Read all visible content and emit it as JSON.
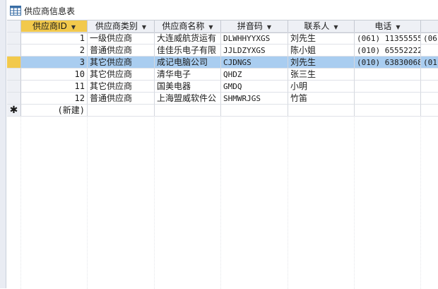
{
  "window": {
    "title": "供应商信息表",
    "icon": "table-icon"
  },
  "columns": [
    "供应商ID",
    "供应商类别",
    "供应商名称",
    "拼音码",
    "联系人",
    "电话",
    ""
  ],
  "rows": [
    [
      "1",
      "一级供应商",
      "大连威航货运有",
      "DLWHHYYXGS",
      "刘先生",
      "(061) 11355555",
      "(06"
    ],
    [
      "2",
      "普通供应商",
      "佳佳乐电子有限",
      "JJLDZYXGS",
      "陈小姐",
      "(010) 65552222",
      ""
    ],
    [
      "3",
      "其它供应商",
      "成记电脑公司",
      "CJDNGS",
      "刘先生",
      "(010) 63830068",
      "(01"
    ],
    [
      "10",
      "其它供应商",
      "清华电子",
      "QHDZ",
      "张三生",
      "",
      ""
    ],
    [
      "11",
      "其它供应商",
      "国美电器",
      "GMDQ",
      "小明",
      "",
      ""
    ],
    [
      "12",
      "普通供应商",
      "上海盟威软件公",
      "SHMWRJGS",
      "竹笛",
      "",
      ""
    ]
  ],
  "new_row": {
    "marker": "✱",
    "label": "(新建)"
  },
  "selected_row_index": 2,
  "colors": {
    "header_bg": "#eef0f5",
    "selected_row": "#a9cdf0",
    "active_marker": "#f2c94c"
  }
}
